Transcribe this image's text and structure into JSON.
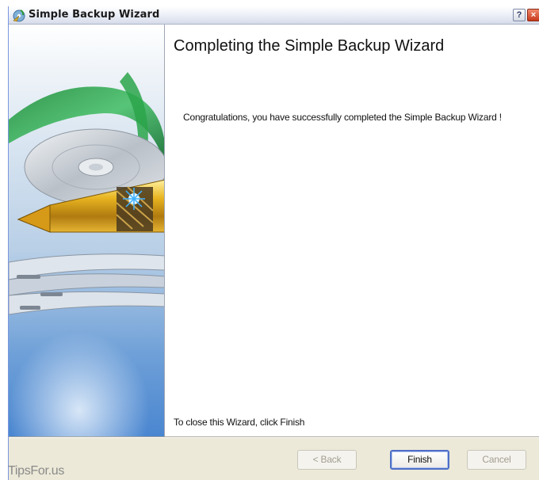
{
  "window": {
    "title": "Simple Backup Wizard",
    "help_label": "?",
    "close_label": "×"
  },
  "content": {
    "heading": "Completing the Simple Backup Wizard",
    "message": "Congratulations, you have successfully completed the Simple Backup Wizard !",
    "close_hint": "To close this Wizard, click Finish"
  },
  "buttons": {
    "back_label": "< Back",
    "finish_label": "Finish",
    "cancel_label": "Cancel"
  },
  "watermark": "TipsFor.us",
  "icons": {
    "app": "backup-wizard-icon",
    "help": "help-icon",
    "close": "close-icon",
    "banner": "disc-pen-illustration"
  },
  "colors": {
    "accent": "#4e6fc7",
    "dialog_bg": "#ece9d8",
    "close_red": "#c8391b"
  }
}
